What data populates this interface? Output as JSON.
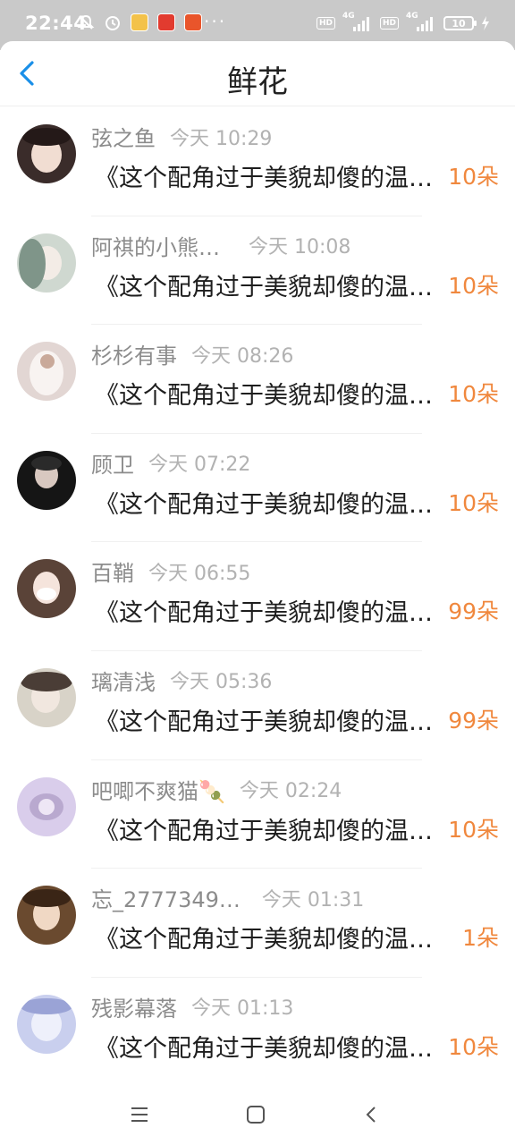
{
  "status_bar": {
    "time": "22:44",
    "dots": "···",
    "hd1": "HD",
    "hd2": "HD",
    "net1": "4G",
    "net2": "4G",
    "battery": "10"
  },
  "header": {
    "title": "鲜花"
  },
  "accent_color": "#f0883e",
  "list": [
    {
      "name": "弦之鱼",
      "time": "今天 10:29",
      "message": "《这个配角过于美貌却傻的温柔》",
      "count": "10朵"
    },
    {
      "name": "阿祺的小熊…",
      "time": "今天 10:08",
      "message": "《这个配角过于美貌却傻的温柔》",
      "count": "10朵"
    },
    {
      "name": "杉杉有事",
      "time": "今天 08:26",
      "message": "《这个配角过于美貌却傻的温柔》",
      "count": "10朵"
    },
    {
      "name": "顾卫",
      "time": "今天 07:22",
      "message": "《这个配角过于美貌却傻的温柔》",
      "count": "10朵"
    },
    {
      "name": "百鞘",
      "time": "今天 06:55",
      "message": "《这个配角过于美貌却傻的温柔》",
      "count": "99朵"
    },
    {
      "name": "璃清浅",
      "time": "今天 05:36",
      "message": "《这个配角过于美貌却傻的温柔》",
      "count": "99朵"
    },
    {
      "name": "吧唧不爽猫🍡",
      "time": "今天 02:24",
      "message": "《这个配角过于美貌却傻的温柔》",
      "count": "10朵"
    },
    {
      "name": "忘_2777349…",
      "time": "今天 01:31",
      "message": "《这个配角过于美貌却傻的温柔》",
      "count": "1朵"
    },
    {
      "name": "残影幕落",
      "time": "今天 01:13",
      "message": "《这个配角过于美貌却傻的温柔》",
      "count": "10朵"
    }
  ]
}
